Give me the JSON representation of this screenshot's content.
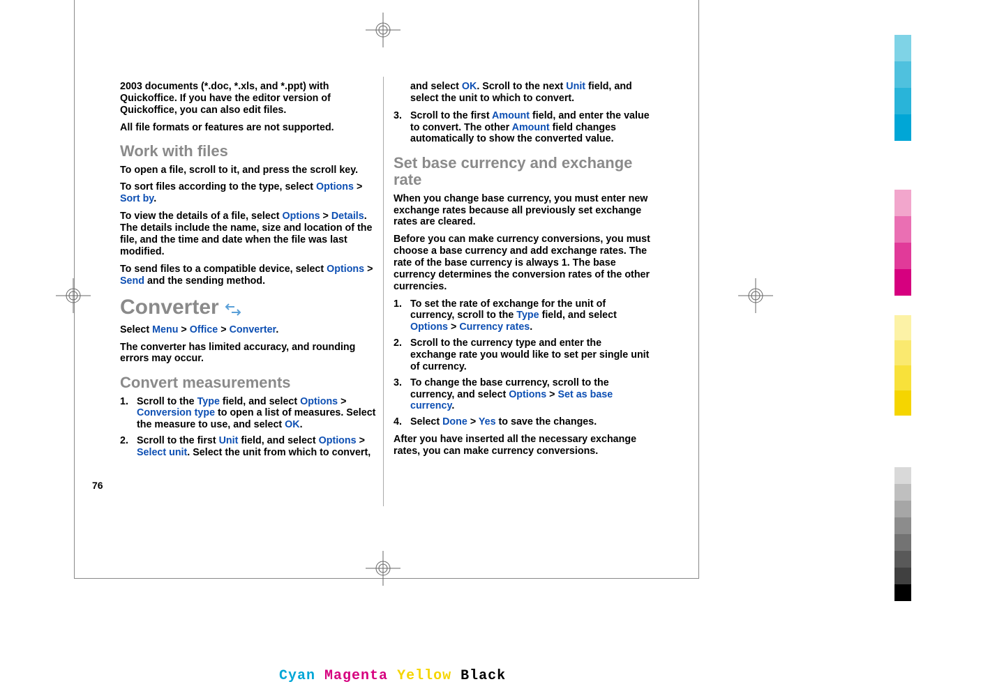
{
  "page_number": "76",
  "left": {
    "intro1": "2003 documents (*.doc, *.xls, and *.ppt) with Quickoffice. If you have the editor version of Quickoffice, you can also edit files.",
    "intro2": "All file formats or features are not supported.",
    "h_work": "Work with files",
    "work_p1": "To open a file, scroll to it, and press the scroll key.",
    "work_p2a": "To sort files according to the type, select ",
    "options": "Options",
    "gt": " > ",
    "sortby": "Sort by",
    "work_p3a": "To view the details of a file, select ",
    "details": "Details",
    "work_p3b": ". The details include the name, size and location of the file, and the time and date when the file was last modified.",
    "work_p4a": "To send files to a compatible device, select ",
    "send": "Send",
    "work_p4b": " and the sending method.",
    "h_converter": "Converter",
    "conv_sel_a": "Select ",
    "menu": "Menu",
    "office": "Office",
    "converter": "Converter",
    "conv_p2": "The converter has limited accuracy, and rounding errors may occur.",
    "h_convmeas": "Convert measurements",
    "cm_1a": "Scroll to the ",
    "type": "Type",
    "cm_1b": " field, and select ",
    "convtype": "Conversion type",
    "cm_1c": " to open a list of measures. Select the measure to use, and select ",
    "ok": "OK",
    "cm_2a": "Scroll to the first ",
    "unit": "Unit",
    "cm_2b": " field, and select ",
    "selunit": "Select unit",
    "cm_2c": ". Select the unit from which to convert,"
  },
  "right": {
    "cont_a": "and select ",
    "ok": "OK",
    "cont_b": ". Scroll to the next ",
    "unit": "Unit",
    "cont_c": " field, and select the unit to which to convert.",
    "step3_a": "Scroll to the first ",
    "amount": "Amount",
    "step3_b": " field, and enter the value to convert. The other ",
    "step3_c": " field changes automatically to show the converted value.",
    "h_base": "Set base currency and exchange rate",
    "base_p1": "When you change base currency, you must enter new exchange rates because all previously set exchange rates are cleared.",
    "base_p2": "Before you can make currency conversions, you must choose a base currency and add exchange rates. The rate of the base currency is always 1. The base currency determines the conversion rates of the other currencies.",
    "s1_a": "To set the rate of exchange for the unit of currency, scroll to the ",
    "type": "Type",
    "s1_b": " field, and select ",
    "options": "Options",
    "gt": " > ",
    "currates": "Currency rates",
    "s2": "Scroll to the currency type and enter the exchange rate you would like to set per single unit of currency.",
    "s3_a": "To change the base currency, scroll to the currency, and select ",
    "setbase": "Set as base currency",
    "s4_a": "Select ",
    "done": "Done",
    "yes": "Yes",
    "s4_b": " to save the changes.",
    "after": "After you have inserted all the necessary exchange rates, you can make currency conversions."
  },
  "cmyk": {
    "c": "Cyan",
    "m": "Magenta",
    "y": "Yellow",
    "k": "Black"
  },
  "colors": {
    "bar1": [
      "#7fd3e6",
      "#4fc1de",
      "#29b4d9",
      "#00a6d6"
    ],
    "bar2": [
      "#f2a6cc",
      "#ea6fb3",
      "#e13a99",
      "#d6007f"
    ],
    "bar3": [
      "#fcf2a6",
      "#fae96f",
      "#f8e13a",
      "#f5d500"
    ],
    "bar4": [
      "#d9d9d9",
      "#bfbfbf",
      "#a6a6a6",
      "#8c8c8c",
      "#737373",
      "#595959",
      "#404040",
      "#000000"
    ]
  }
}
